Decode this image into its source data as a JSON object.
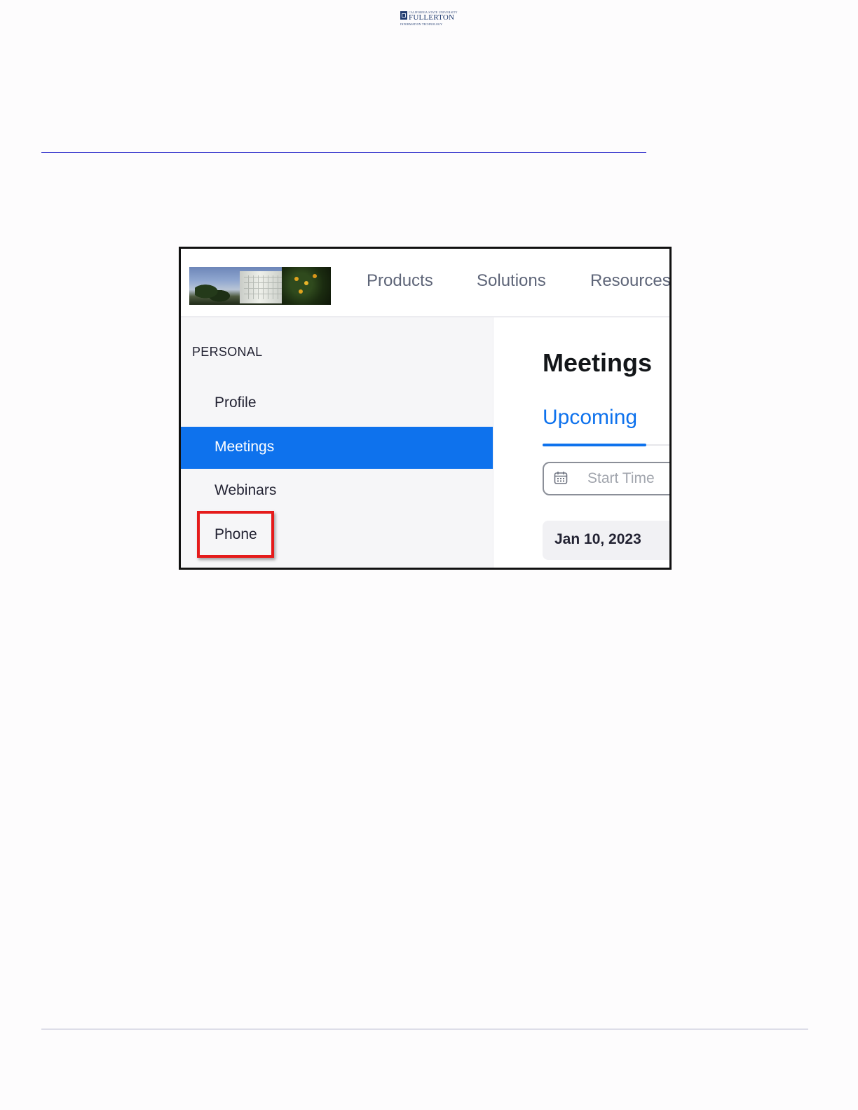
{
  "document": {
    "logo": {
      "line1": "CALIFORNIA STATE UNIVERSITY",
      "line2": "FULLERTON",
      "line3": "INFORMATION TECHNOLOGY"
    }
  },
  "screenshot": {
    "nav": {
      "items": [
        "Products",
        "Solutions",
        "Resources"
      ]
    },
    "sidebar": {
      "section": "PERSONAL",
      "items": [
        {
          "label": "Profile",
          "active": false
        },
        {
          "label": "Meetings",
          "active": true
        },
        {
          "label": "Webinars",
          "active": false
        },
        {
          "label": "Phone",
          "active": false,
          "highlighted": true
        }
      ]
    },
    "main": {
      "title": "Meetings",
      "active_tab": "Upcoming",
      "date_filter_placeholder": "Start Time",
      "date_chip": "Jan 10, 2023"
    },
    "colors": {
      "accent": "#0e72ed",
      "highlight": "#e51b1b",
      "rule": "#3333cc"
    },
    "icons": {
      "date_filter": "calendar-icon"
    }
  }
}
